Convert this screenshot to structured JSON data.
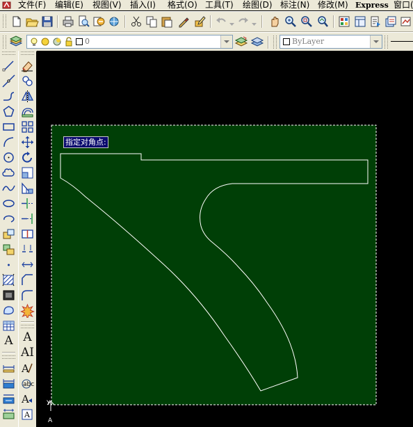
{
  "menubar": {
    "items": [
      {
        "label": "文件(F)"
      },
      {
        "label": "编辑(E)"
      },
      {
        "label": "视图(V)"
      },
      {
        "label": "插入(I)"
      },
      {
        "label": "格式(O)"
      },
      {
        "label": "工具(T)"
      },
      {
        "label": "绘图(D)"
      },
      {
        "label": "标注(N)"
      },
      {
        "label": "修改(M)"
      },
      {
        "label": "Express"
      },
      {
        "label": "窗口("
      }
    ]
  },
  "layers_toolbar": {
    "layer_value": "0",
    "color_value": "ByLayer"
  },
  "drawing": {
    "prompt": "指定对角点:",
    "ucs_y_label": "Y",
    "ucs_axis_label": "A",
    "colors": {
      "background": "#000000",
      "selection_fill": "#003f06",
      "selection_border": "#ffffff",
      "geometry": "#ffffff",
      "prompt_bg": "#0a0a6e"
    }
  },
  "icons": {
    "standard": [
      "new-file-icon",
      "open-icon",
      "save-icon",
      "print-icon",
      "print-preview-icon",
      "publish-icon",
      "3d-dwf-icon",
      "cut-icon",
      "copy-icon",
      "paste-icon",
      "match-properties-icon",
      "block-editor-icon",
      "undo-icon",
      "redo-icon",
      "pan-icon",
      "zoom-realtime-icon",
      "zoom-window-icon",
      "zoom-previous-icon",
      "properties-icon",
      "design-center-icon",
      "tool-palettes-icon",
      "sheet-set-icon",
      "markup-icon"
    ],
    "draw": [
      "line-icon",
      "construction-line-icon",
      "polyline-icon",
      "polygon-icon",
      "rectangle-icon",
      "arc-icon",
      "circle-icon",
      "revision-cloud-icon",
      "spline-icon",
      "ellipse-icon",
      "ellipse-arc-icon",
      "insert-block-icon",
      "make-block-icon",
      "point-icon",
      "hatch-icon",
      "gradient-icon",
      "region-icon",
      "table-icon",
      "multiline-text-icon",
      "dimension-icon",
      "layer-icon",
      "text-icon"
    ],
    "modify": [
      "erase-icon",
      "copy-object-icon",
      "mirror-icon",
      "offset-icon",
      "array-icon",
      "move-icon",
      "rotate-icon",
      "scale-icon",
      "stretch-icon",
      "trim-icon",
      "extend-icon",
      "break-at-point-icon",
      "break-icon",
      "join-icon",
      "chamfer-icon",
      "fillet-icon",
      "explode-icon",
      "text-style-icon",
      "multiline-text-edit-icon",
      "text-edit-icon",
      "spell-check-icon",
      "find-replace-icon",
      "attribute-icon"
    ]
  }
}
